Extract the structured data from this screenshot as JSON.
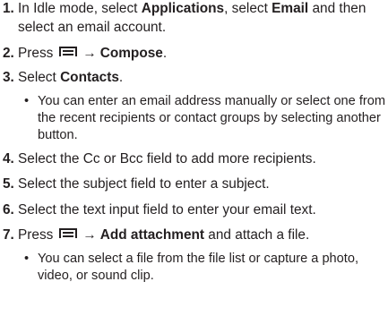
{
  "steps": [
    {
      "number": "1.",
      "line1_pre": "In Idle mode, select ",
      "line1_bold1": "Applications",
      "line1_mid": ", select ",
      "line1_bold2": "Email",
      "line1_post": " and then",
      "line2": "select an email account."
    },
    {
      "number": "2.",
      "pre": "Press",
      "arrow": "→",
      "bold": "Compose",
      "post": "."
    },
    {
      "number": "3.",
      "pre": "Select ",
      "bold": "Contacts",
      "post": ".",
      "note_lines": [
        "You can enter an email address manually or select one from",
        "the recent recipients or contact groups by selecting another",
        "button."
      ]
    },
    {
      "number": "4.",
      "text": "Select the Cc or Bcc field to add more recipients."
    },
    {
      "number": "5.",
      "text": "Select the subject field to enter a subject."
    },
    {
      "number": "6.",
      "text": "Select the text input field to enter your email text."
    },
    {
      "number": "7.",
      "pre": "Press",
      "arrow": "→",
      "bold": "Add attachment",
      "post": " and attach a file.",
      "note_lines": [
        "You can select a file from the file list or capture a photo,",
        "video, or sound clip."
      ]
    }
  ],
  "bullet_glyph": "•",
  "icons": {
    "menu_key": "menu-key-icon"
  }
}
